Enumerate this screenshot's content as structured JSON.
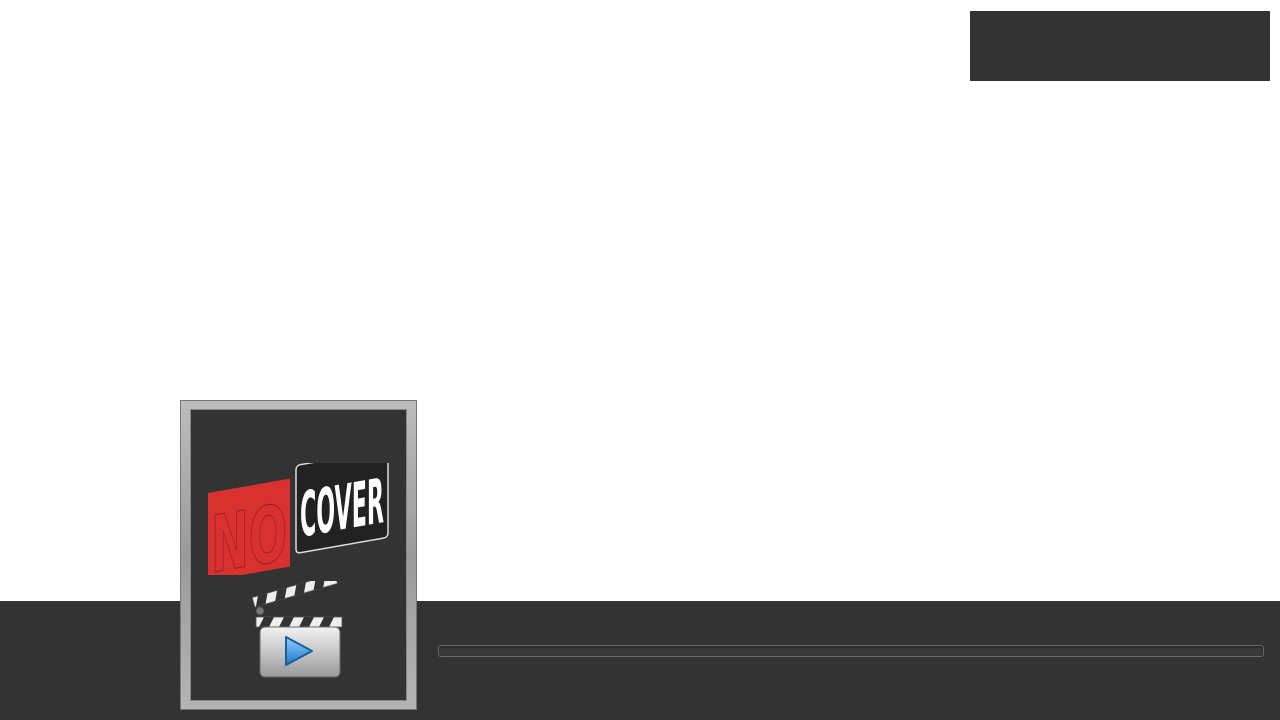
{
  "poster": {
    "placeholder_text": "NO COVER",
    "logo_word_red": "NO",
    "logo_word_white": "COVER",
    "icon": "clapperboard-play-icon"
  },
  "top_panel": {
    "icon": "none"
  },
  "progress": {
    "value": 0.0
  },
  "colors": {
    "background": "#ffffff",
    "panel": "#333333",
    "accent_red": "#d93030",
    "play_blue": "#3a9ee8"
  }
}
